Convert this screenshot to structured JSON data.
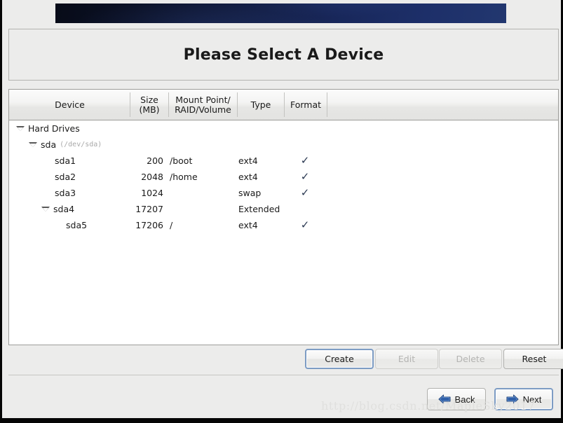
{
  "window": {
    "title": "Please Select A Device"
  },
  "banner": {
    "accent_dark": "#070b18",
    "accent_light": "#22376f"
  },
  "table": {
    "columns": [
      {
        "key": "device",
        "label": "Device"
      },
      {
        "key": "size",
        "label_line1": "Size",
        "label_line2": "(MB)"
      },
      {
        "key": "mount",
        "label_line1": "Mount Point/",
        "label_line2": "RAID/Volume"
      },
      {
        "key": "type",
        "label": "Type"
      },
      {
        "key": "format",
        "label": "Format"
      }
    ],
    "rows": [
      {
        "name": "Hard Drives",
        "devpath": "",
        "size": "",
        "mount": "",
        "type": "",
        "format": false,
        "expander": true,
        "indent": 0
      },
      {
        "name": "sda",
        "devpath": "(/dev/sda)",
        "size": "",
        "mount": "",
        "type": "",
        "format": false,
        "expander": true,
        "indent": 1
      },
      {
        "name": "sda1",
        "devpath": "",
        "size": "200",
        "mount": "/boot",
        "type": "ext4",
        "format": true,
        "expander": false,
        "indent": 2
      },
      {
        "name": "sda2",
        "devpath": "",
        "size": "2048",
        "mount": "/home",
        "type": "ext4",
        "format": true,
        "expander": false,
        "indent": 2
      },
      {
        "name": "sda3",
        "devpath": "",
        "size": "1024",
        "mount": "",
        "type": "swap",
        "format": true,
        "expander": false,
        "indent": 2
      },
      {
        "name": "sda4",
        "devpath": "",
        "size": "17207",
        "mount": "",
        "type": "Extended",
        "format": false,
        "expander": true,
        "indent": 2
      },
      {
        "name": "sda5",
        "devpath": "",
        "size": "17206",
        "mount": "/",
        "type": "ext4",
        "format": true,
        "expander": false,
        "indent": 3
      }
    ],
    "check_glyph": "✓",
    "check_color": "#2b3952"
  },
  "actions": {
    "create_label": "Create",
    "edit_label": "Edit",
    "delete_label": "Delete",
    "reset_label": "Reset"
  },
  "navigation": {
    "back_label": "Back",
    "next_label": "Next",
    "arrow_color": "#2f5fa8"
  },
  "watermark": {
    "text": "http://blog.csdn.net/MapleSky2017"
  }
}
